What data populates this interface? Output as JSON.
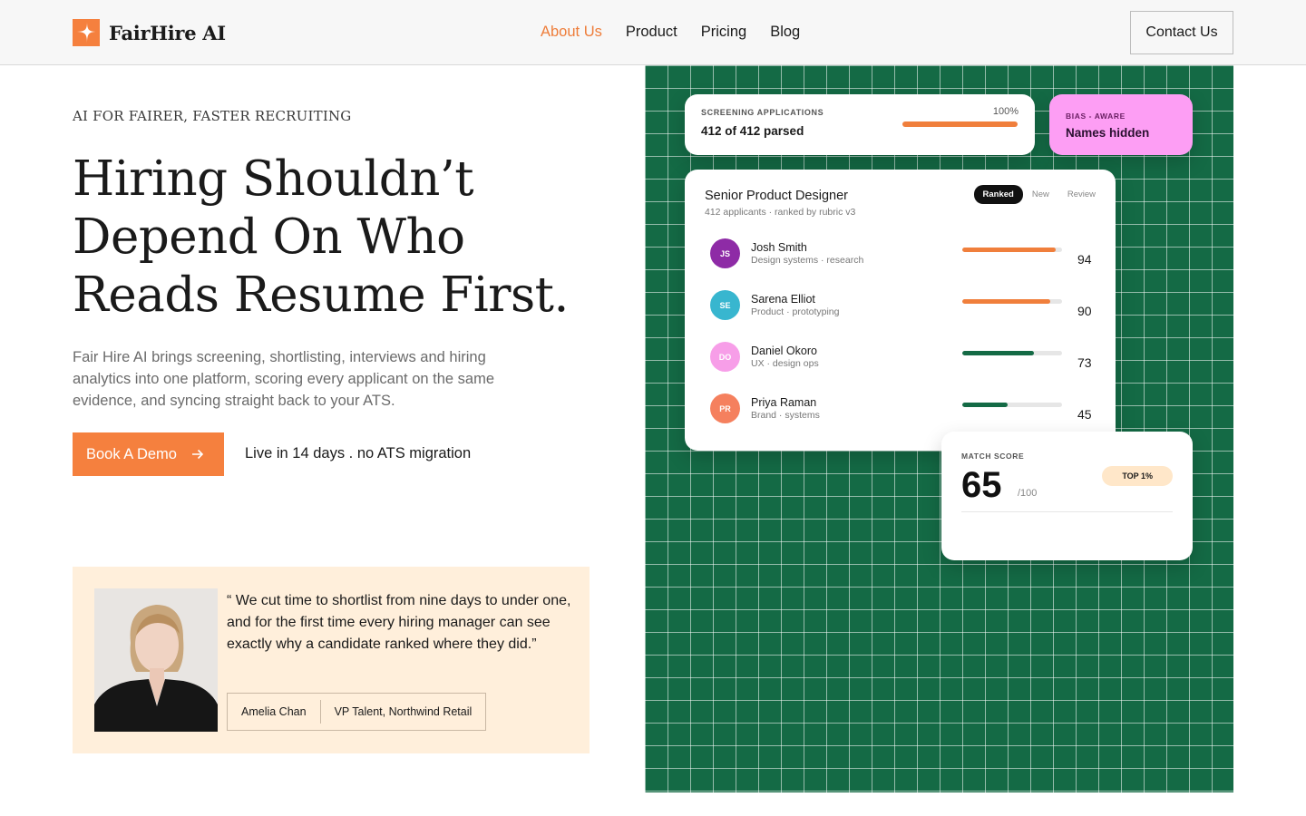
{
  "brand": {
    "name": "FairHire AI",
    "accent": "#F5803E"
  },
  "nav": {
    "items": [
      {
        "label": "About Us",
        "active": true
      },
      {
        "label": "Product",
        "active": false
      },
      {
        "label": "Pricing",
        "active": false
      },
      {
        "label": "Blog",
        "active": false
      }
    ],
    "contact_label": "Contact Us"
  },
  "hero": {
    "eyebrow": "AI FOR FAIRER, FASTER RECRUITING",
    "title_line1": "Hiring Shouldn’t",
    "title_line2": "Depend On Who",
    "title_line3": "Reads Resume First.",
    "description": "Fair Hire AI brings screening, shortlisting, interviews and hiring analytics into one platform, scoring every applicant on the same evidence, and syncing straight back to your ATS.",
    "cta_label": "Book A Demo",
    "cta_icon": "arrow-right-icon",
    "note": "Live in 14 days . no ATS migration"
  },
  "testimonial": {
    "quote": "“ We cut time to shortlist from nine days to under one, and for the first time every hiring manager can see exactly why a candidate ranked where they did.”",
    "name": "Amelia Chan",
    "role": "VP Talent, Northwind Retail"
  },
  "visual": {
    "background": "#146A45",
    "screening": {
      "label": "SCREENING APPLICATIONS",
      "percent": "100%",
      "progress": 1.0,
      "parsed": "412 of 412 parsed"
    },
    "bias": {
      "label": "BIAS - AWARE",
      "text": "Names hidden",
      "color": "#FD9EF4"
    },
    "ranking": {
      "title": "Senior Product Designer",
      "subtitle": "412 applicants · ranked by rubric v3",
      "tabs": [
        {
          "label": "Ranked",
          "active": true
        },
        {
          "label": "New",
          "active": false
        },
        {
          "label": "Review",
          "active": false
        }
      ],
      "candidates": [
        {
          "initials": "JS",
          "name": "Josh Smith",
          "role": "Design systems · research",
          "score": "94",
          "fill": 0.94,
          "avatar_color": "#8E2BA6",
          "bar_color": "#F07F3C"
        },
        {
          "initials": "SE",
          "name": "Sarena Elliot",
          "role": "Product · prototyping",
          "score": "90",
          "fill": 0.88,
          "avatar_color": "#38B6CF",
          "bar_color": "#F07F3C"
        },
        {
          "initials": "DO",
          "name": "Daniel Okoro",
          "role": "UX · design ops",
          "score": "73",
          "fill": 0.72,
          "avatar_color": "#F79EE8",
          "bar_color": "#146A45"
        },
        {
          "initials": "PR",
          "name": "Priya Raman",
          "role": "Brand · systems",
          "score": "45",
          "fill": 0.45,
          "avatar_color": "#F5805E",
          "bar_color": "#146A45"
        }
      ]
    },
    "match": {
      "label": "MATCH SCORE",
      "score": "65",
      "out_of": "/100",
      "badge": "TOP 1%"
    }
  }
}
